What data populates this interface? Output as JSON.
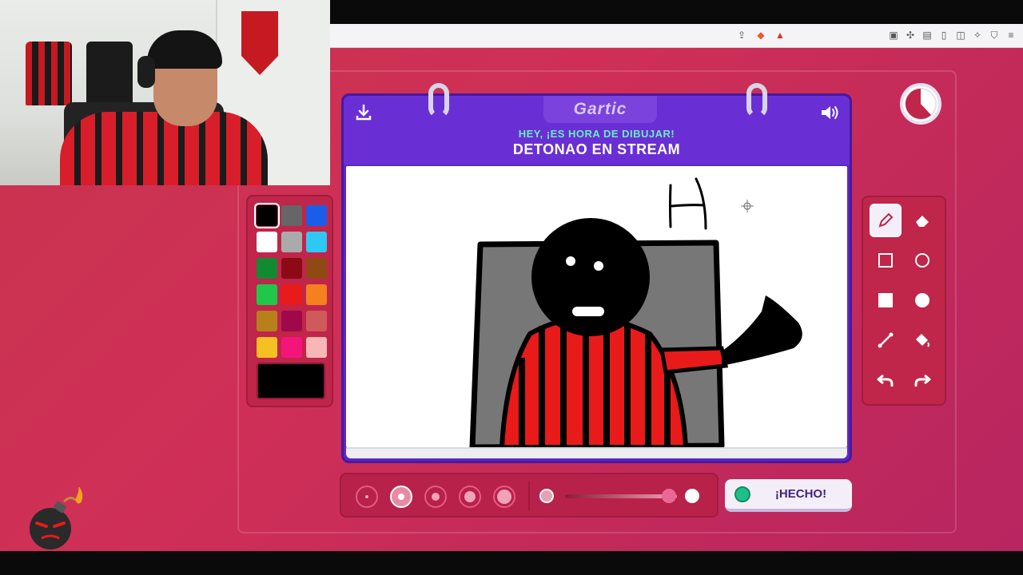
{
  "game": {
    "logo": "Gartic",
    "prompt": "HEY, ¡ES HORA DE DIBUJAR!",
    "word": "DETONAO EN STREAM",
    "done_label": "¡HECHO!"
  },
  "palette": {
    "colors": [
      "#000000",
      "#666666",
      "#1a5ee8",
      "#ffffff",
      "#aaaaaa",
      "#2fc8f5",
      "#128a32",
      "#8c0a14",
      "#8e4a12",
      "#20c84a",
      "#e81a1a",
      "#f58020",
      "#b8801a",
      "#a0084a",
      "#cf5a5a",
      "#f5c022",
      "#f5157a",
      "#f9b6b6"
    ],
    "selected_index": 0,
    "current_color": "#000000"
  },
  "tools": [
    "pencil-icon",
    "eraser-icon",
    "square-outline-icon",
    "circle-outline-icon",
    "square-filled-icon",
    "circle-filled-icon",
    "line-icon",
    "fill-bucket-icon",
    "undo-icon",
    "redo-icon"
  ],
  "brush": {
    "selected_size_index": 1,
    "opacity": 1.0
  },
  "colors": {
    "accent": "#5e26c4",
    "background": "#c9344e",
    "prompt": "#65f0c4"
  }
}
